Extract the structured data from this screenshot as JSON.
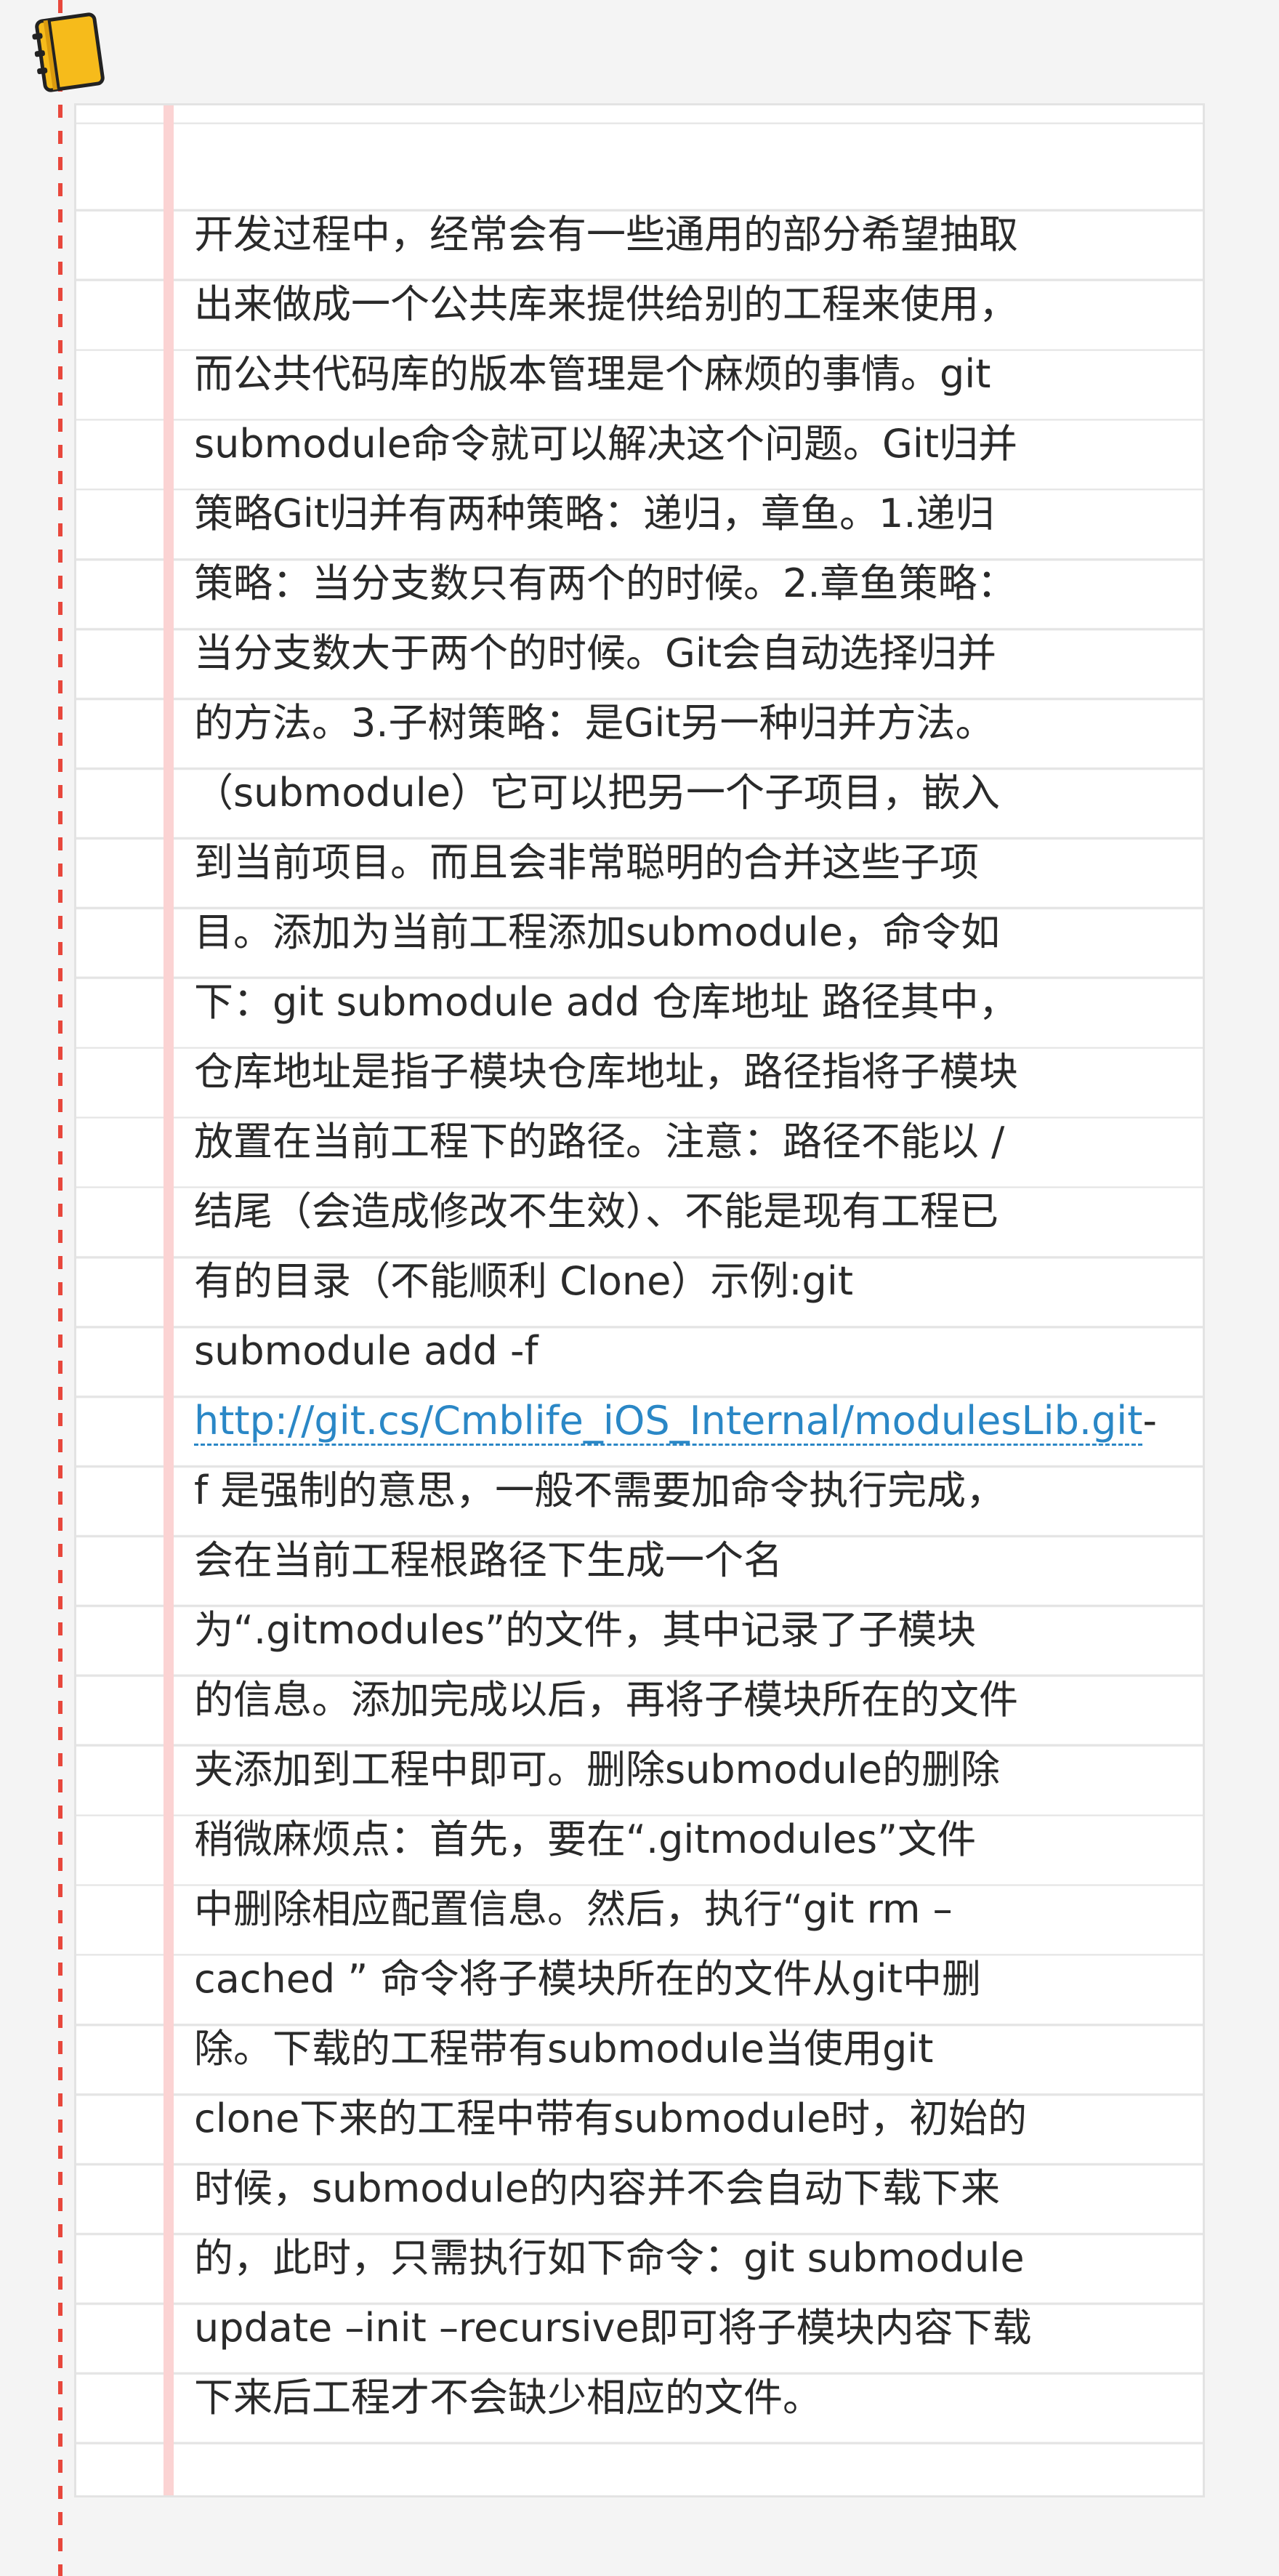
{
  "article": {
    "lines": [
      "开发过程中，经常会有一些通用的部分希望抽取",
      "出来做成一个公共库来提供给别的工程来使用，",
      "而公共代码库的版本管理是个麻烦的事情。git",
      "submodule命令就可以解决这个问题。Git归并",
      "策略Git归并有两种策略：递归，章鱼。1.递归",
      "策略：当分支数只有两个的时候。2.章鱼策略：",
      "当分支数大于两个的时候。Git会自动选择归并",
      "的方法。3.子树策略：是Git另一种归并方法。",
      "（submodule）它可以把另一个子项目，嵌入",
      "到当前项目。而且会非常聪明的合并这些子项",
      "目。添加为当前工程添加submodule，命令如",
      "下：git submodule add 仓库地址 路径其中，",
      "仓库地址是指子模块仓库地址，路径指将子模块",
      "放置在当前工程下的路径。注意：路径不能以 /",
      "结尾（会造成修改不生效）、不能是现有工程已",
      "有的目录（不能顺利 Clone）示例:git",
      "submodule add -f"
    ],
    "link_text": "http://git.cs/Cmblife_iOS_Internal/modulesLib.git",
    "link_suffix": "-",
    "lines_after": [
      "f 是强制的意思，一般不需要加命令执行完成，",
      "会在当前工程根路径下生成一个名",
      "为“.gitmodules”的文件，其中记录了子模块",
      "的信息。添加完成以后，再将子模块所在的文件",
      "夹添加到工程中即可。删除submodule的删除",
      "稍微麻烦点：首先，要在“.gitmodules”文件",
      "中删除相应配置信息。然后，执行“git rm –",
      "cached ” 命令将子模块所在的文件从git中删",
      "除。下载的工程带有submodule当使用git",
      "clone下来的工程中带有submodule时，初始的",
      "时候，submodule的内容并不会自动下载下来",
      "的，此时，只需执行如下命令：git submodule",
      "update –init –recursive即可将子模块内容下载",
      "下来后工程才不会缺少相应的文件。"
    ]
  },
  "icons": {
    "notebook": "notebook-icon"
  },
  "colors": {
    "margin_dash": "#e8473c",
    "link": "#2a87c6",
    "icon_yellow": "#f6bb1b"
  }
}
